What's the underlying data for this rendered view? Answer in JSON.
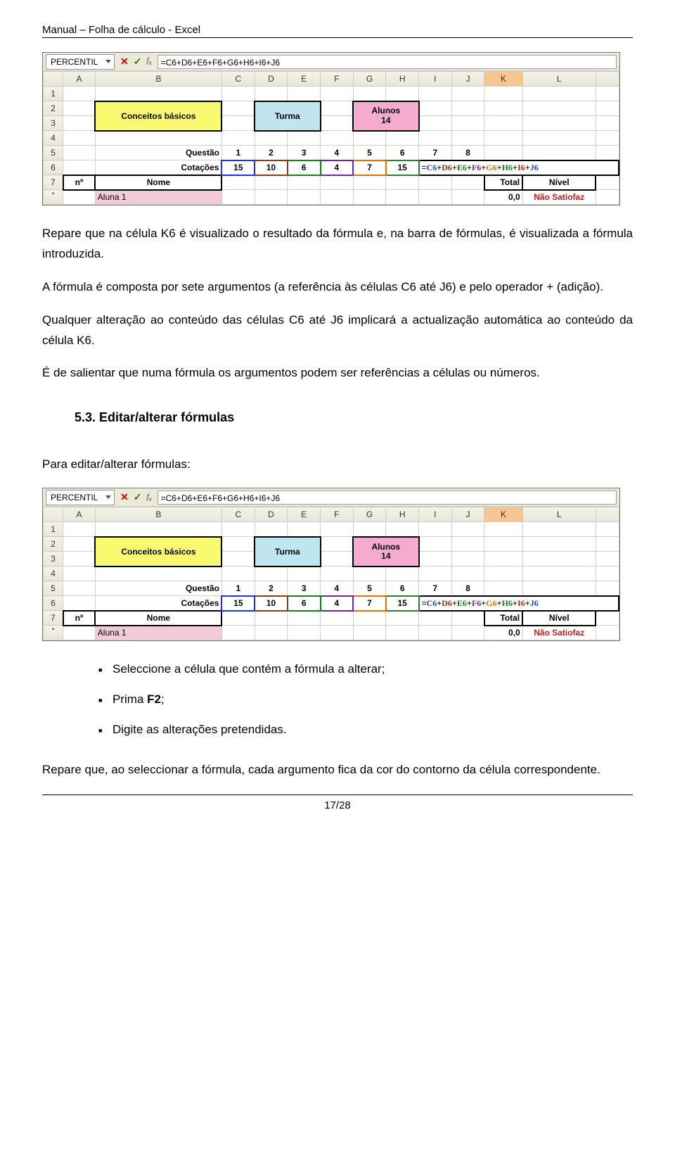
{
  "doc": {
    "header": "Manual – Folha de cálculo - Excel",
    "page_label": "17/28"
  },
  "excel": {
    "namebox": "PERCENTIL",
    "formula": "=C6+D6+E6+F6+G6+H6+I6+J6",
    "columns": [
      "A",
      "B",
      "C",
      "D",
      "E",
      "F",
      "G",
      "H",
      "I",
      "J",
      "K",
      "L"
    ],
    "row_nums": [
      "1",
      "2",
      "3",
      "4",
      "5",
      "6",
      "7",
      "•"
    ],
    "conceitos": "Conceitos básicos",
    "turma": "Turma",
    "alunos_label": "Alunos",
    "alunos_count": "14",
    "questao_label": "Questão",
    "questao_nums": [
      "1",
      "2",
      "3",
      "4",
      "5",
      "6",
      "7",
      "8"
    ],
    "cotacoes_label": "Cotações",
    "cotacoes_vals": [
      "15",
      "10",
      "6",
      "4",
      "7",
      "15"
    ],
    "k6_formula": {
      "c6": "C6",
      "d6": "D6",
      "e6": "E6",
      "f6": "F6",
      "g6": "G6",
      "h6": "H6",
      "i6": "I6",
      "j6": "J6"
    },
    "no_label": "nº",
    "nome_label": "Nome",
    "total_label": "Total",
    "nivel_label": "Nível",
    "aluno1": "Aluna 1",
    "zero": "0,0",
    "nivel_val": "Não Satiofaz"
  },
  "text": {
    "p1": "Repare que na célula K6 é visualizado o resultado da fórmula e, na barra de fórmulas, é visualizada a fórmula introduzida.",
    "p2": "A fórmula é composta por sete argumentos (a referência às células C6 até J6) e pelo operador + (adição).",
    "p3": "Qualquer alteração ao conteúdo das células C6 até J6 implicará a actualização automática ao conteúdo da célula K6.",
    "p4": "É de salientar que numa fórmula os argumentos podem ser referências a células ou números.",
    "section": "5.3. Editar/alterar fórmulas",
    "p5": "Para editar/alterar fórmulas:",
    "bullets": [
      "Seleccione a célula que contém a fórmula a alterar;",
      "Prima F2;",
      "Digite as alterações pretendidas."
    ],
    "bullet2_prefix": "Prima ",
    "bullet2_bold": "F2",
    "bullet2_suffix": ";",
    "p6": "Repare que, ao seleccionar a fórmula, cada argumento fica da cor do contorno da célula correspondente."
  }
}
